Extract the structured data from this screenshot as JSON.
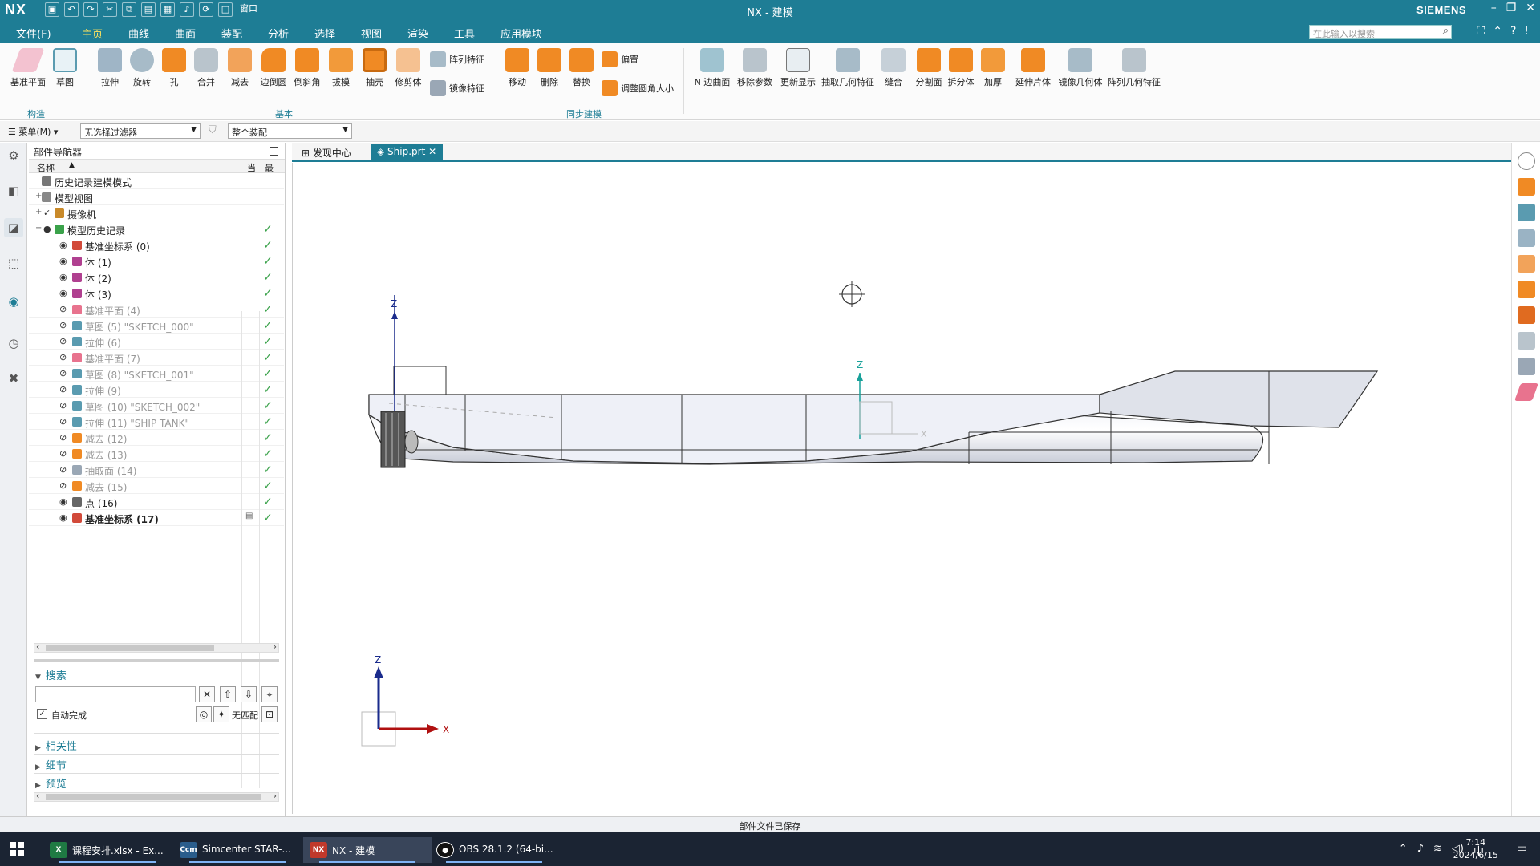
{
  "app": {
    "logo": "NX",
    "title": "NX - 建模",
    "brand": "SIEMENS",
    "qat_window": "窗口"
  },
  "menu": {
    "file": "文件(F)",
    "tabs": [
      "主页",
      "曲线",
      "曲面",
      "装配",
      "分析",
      "选择",
      "视图",
      "渲染",
      "工具",
      "应用模块"
    ],
    "search_placeholder": "在此输入以搜索"
  },
  "ribbon": {
    "construct": {
      "group": "构造",
      "buttons": [
        "基准平面",
        "草图"
      ]
    },
    "basic": {
      "group": "基本",
      "buttons": [
        "拉伸",
        "旋转",
        "孔",
        "合并",
        "减去",
        "边倒圆",
        "倒斜角",
        "拔模",
        "抽壳",
        "修剪体"
      ],
      "small": [
        "阵列特征",
        "镜像特征"
      ]
    },
    "sync": {
      "group": "同步建模",
      "buttons": [
        "移动",
        "删除",
        "替换"
      ],
      "small": [
        "偏置",
        "调整圆角大小"
      ]
    },
    "more": [
      "N 边曲面",
      "移除参数",
      "更新显示",
      "抽取几何特征",
      "缝合",
      "分割面",
      "拆分体",
      "加厚",
      "延伸片体",
      "镜像几何体",
      "阵列几何特征"
    ],
    "colors": {
      "orange": "#f08a24",
      "teal": "#5a9bb0",
      "gray": "#9aa7b5",
      "pink": "#e8738e"
    }
  },
  "selbar": {
    "menu": "菜单(M)",
    "filter": "无选择过滤器",
    "scope": "整个装配"
  },
  "navigator": {
    "title": "部件导航器",
    "col_name": "名称",
    "col_a": "当",
    "col_b": "最",
    "rows": [
      {
        "label": "历史记录建模模式",
        "icon": "clock-icon",
        "indent": 0,
        "expander": "",
        "visible": "",
        "check": false,
        "dim": false,
        "bold": false
      },
      {
        "label": "模型视图",
        "icon": "view-icon",
        "indent": 0,
        "expander": "+",
        "visible": "",
        "check": false,
        "dim": false,
        "bold": false
      },
      {
        "label": "摄像机",
        "icon": "camera-icon",
        "indent": 0,
        "expander": "+",
        "visible": "✓",
        "check": false,
        "dim": false,
        "bold": false
      },
      {
        "label": "模型历史记录",
        "icon": "history-icon",
        "indent": 0,
        "expander": "−",
        "visible": "●",
        "check": true,
        "dim": false,
        "bold": false
      },
      {
        "label": "基准坐标系 (0)",
        "icon": "csys-icon",
        "indent": 1,
        "expander": "",
        "visible": "◉",
        "check": true,
        "dim": false,
        "bold": false
      },
      {
        "label": "体 (1)",
        "icon": "body-icon",
        "indent": 1,
        "expander": "",
        "visible": "◉",
        "check": true,
        "dim": false,
        "bold": false
      },
      {
        "label": "体 (2)",
        "icon": "body-icon",
        "indent": 1,
        "expander": "",
        "visible": "◉",
        "check": true,
        "dim": false,
        "bold": false
      },
      {
        "label": "体 (3)",
        "icon": "body-icon",
        "indent": 1,
        "expander": "",
        "visible": "◉",
        "check": true,
        "dim": false,
        "bold": false
      },
      {
        "label": "基准平面 (4)",
        "icon": "plane-icon",
        "indent": 1,
        "expander": "",
        "visible": "⊘",
        "check": true,
        "dim": true,
        "bold": false
      },
      {
        "label": "草图 (5) \"SKETCH_000\"",
        "icon": "sketch-icon",
        "indent": 1,
        "expander": "",
        "visible": "⊘",
        "check": true,
        "dim": true,
        "bold": false
      },
      {
        "label": "拉伸 (6)",
        "icon": "extrude-icon",
        "indent": 1,
        "expander": "",
        "visible": "⊘",
        "check": true,
        "dim": true,
        "bold": false
      },
      {
        "label": "基准平面 (7)",
        "icon": "plane-icon",
        "indent": 1,
        "expander": "",
        "visible": "⊘",
        "check": true,
        "dim": true,
        "bold": false
      },
      {
        "label": "草图 (8) \"SKETCH_001\"",
        "icon": "sketch-icon",
        "indent": 1,
        "expander": "",
        "visible": "⊘",
        "check": true,
        "dim": true,
        "bold": false
      },
      {
        "label": "拉伸 (9)",
        "icon": "extrude-icon",
        "indent": 1,
        "expander": "",
        "visible": "⊘",
        "check": true,
        "dim": true,
        "bold": false
      },
      {
        "label": "草图 (10) \"SKETCH_002\"",
        "icon": "sketch-icon",
        "indent": 1,
        "expander": "",
        "visible": "⊘",
        "check": true,
        "dim": true,
        "bold": false
      },
      {
        "label": "拉伸 (11) \"SHIP TANK\"",
        "icon": "extrude-icon",
        "indent": 1,
        "expander": "",
        "visible": "⊘",
        "check": true,
        "dim": true,
        "bold": false
      },
      {
        "label": "减去 (12)",
        "icon": "subtract-icon",
        "indent": 1,
        "expander": "",
        "visible": "⊘",
        "check": true,
        "dim": true,
        "bold": false
      },
      {
        "label": "减去 (13)",
        "icon": "subtract-icon",
        "indent": 1,
        "expander": "",
        "visible": "⊘",
        "check": true,
        "dim": true,
        "bold": false
      },
      {
        "label": "抽取面 (14)",
        "icon": "extract-icon",
        "indent": 1,
        "expander": "",
        "visible": "⊘",
        "check": true,
        "dim": true,
        "bold": false
      },
      {
        "label": "减去 (15)",
        "icon": "subtract-icon",
        "indent": 1,
        "expander": "",
        "visible": "⊘",
        "check": true,
        "dim": true,
        "bold": false
      },
      {
        "label": "点 (16)",
        "icon": "point-icon",
        "indent": 1,
        "expander": "",
        "visible": "◉",
        "check": true,
        "dim": false,
        "bold": false
      },
      {
        "label": "基准坐标系 (17)",
        "icon": "csys-icon",
        "indent": 1,
        "expander": "",
        "visible": "◉",
        "check": true,
        "dim": false,
        "bold": true
      }
    ],
    "search_title": "搜索",
    "autocomplete": "自动完成",
    "nomatch": "无匹配",
    "sections": [
      "相关性",
      "细节",
      "预览"
    ]
  },
  "tabs": [
    {
      "label": "发现中心"
    },
    {
      "label": "Ship.prt"
    }
  ],
  "viewport": {
    "axis_z": "Z",
    "axis_x": "X"
  },
  "status": "部件文件已保存",
  "taskbar": {
    "items": [
      {
        "label": "课程安排.xlsx - Ex...",
        "icon": "X"
      },
      {
        "label": "Simcenter STAR-...",
        "icon": "Ccm"
      },
      {
        "label": "NX - 建模",
        "icon": "NX"
      },
      {
        "label": "OBS 28.1.2 (64-bi...",
        "icon": "●"
      }
    ],
    "time": "7:14",
    "date": "2024/6/15",
    "ime": "中"
  }
}
